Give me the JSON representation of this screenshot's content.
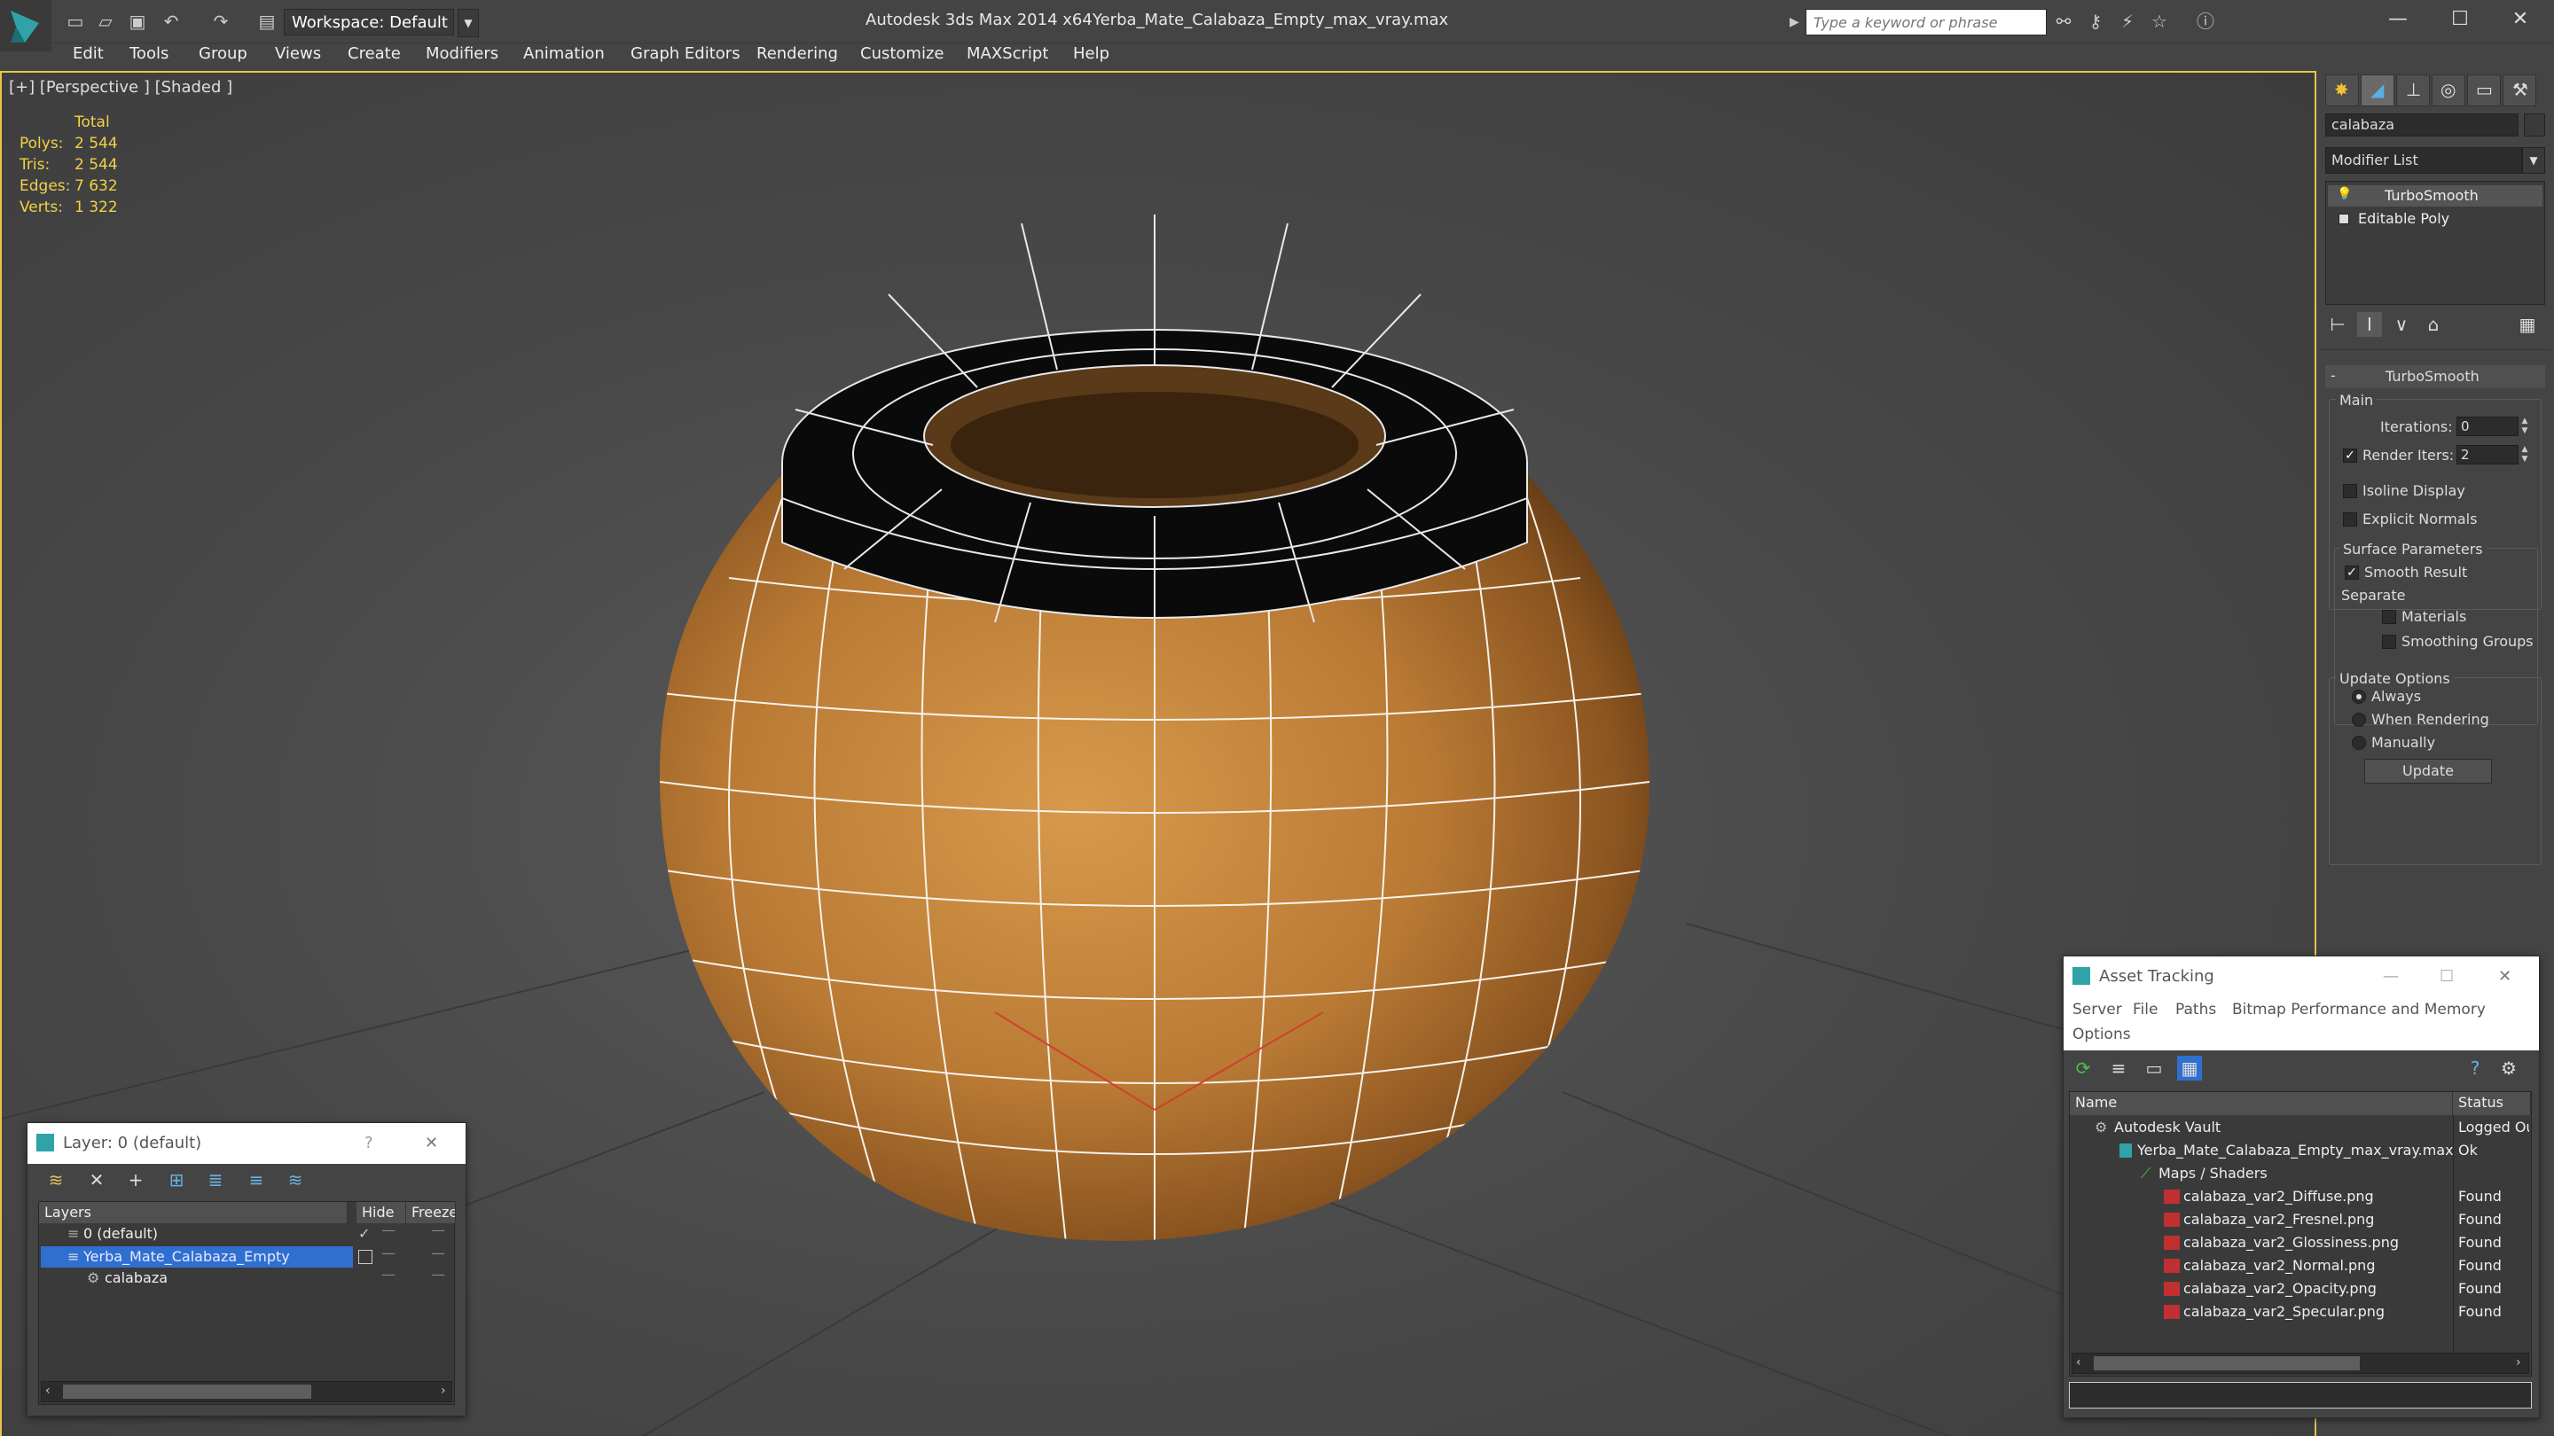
{
  "titlebar": {
    "workspace_label": "Workspace: Default",
    "app_name": "Autodesk 3ds Max  2014 x64",
    "file_name": "Yerba_Mate_Calabaza_Empty_max_vray.max",
    "search_placeholder": "Type a keyword or phrase"
  },
  "menu": [
    "Edit",
    "Tools",
    "Group",
    "Views",
    "Create",
    "Modifiers",
    "Animation",
    "Graph Editors",
    "Rendering",
    "Customize",
    "MAXScript",
    "Help"
  ],
  "viewport": {
    "label": "[+] [Perspective ] [Shaded ]",
    "stats_header": "Total",
    "stats": [
      {
        "label": "Polys:",
        "value": "2 544"
      },
      {
        "label": "Tris:",
        "value": "2 544"
      },
      {
        "label": "Edges:",
        "value": "7 632"
      },
      {
        "label": "Verts:",
        "value": "1 322"
      }
    ]
  },
  "command_panel": {
    "object_name": "calabaza",
    "modifier_list_label": "Modifier List",
    "stack": [
      "TurboSmooth",
      "Editable Poly"
    ],
    "rollout_title": "TurboSmooth",
    "main_group": "Main",
    "iterations_label": "Iterations:",
    "iterations_value": "0",
    "render_iters_label": "Render Iters:",
    "render_iters_value": "2",
    "isoline_label": "Isoline Display",
    "explicit_normals_label": "Explicit Normals",
    "surface_group": "Surface Parameters",
    "smooth_result_label": "Smooth Result",
    "separate_label": "Separate",
    "materials_label": "Materials",
    "smoothing_groups_label": "Smoothing Groups",
    "update_group": "Update Options",
    "always_label": "Always",
    "when_rendering_label": "When Rendering",
    "manually_label": "Manually",
    "update_button": "Update"
  },
  "layer_window": {
    "title": "Layer: 0 (default)",
    "help_icon": "?",
    "columns": [
      "Layers",
      "Hide",
      "Freeze"
    ],
    "rows": [
      "0 (default)",
      "Yerba_Mate_Calabaza_Empty",
      "calabaza"
    ]
  },
  "asset_window": {
    "title": "Asset Tracking",
    "menu": [
      "Server",
      "File",
      "Paths",
      "Bitmap Performance and Memory",
      "Options"
    ],
    "columns": [
      "Name",
      "Status"
    ],
    "rows": [
      {
        "name": "Autodesk Vault",
        "status": "Logged Out"
      },
      {
        "name": "Yerba_Mate_Calabaza_Empty_max_vray.max",
        "status": "Ok"
      },
      {
        "name": "Maps / Shaders",
        "status": ""
      },
      {
        "name": "calabaza_var2_Diffuse.png",
        "status": "Found"
      },
      {
        "name": "calabaza_var2_Fresnel.png",
        "status": "Found"
      },
      {
        "name": "calabaza_var2_Glossiness.png",
        "status": "Found"
      },
      {
        "name": "calabaza_var2_Normal.png",
        "status": "Found"
      },
      {
        "name": "calabaza_var2_Opacity.png",
        "status": "Found"
      },
      {
        "name": "calabaza_var2_Specular.png",
        "status": "Found"
      }
    ]
  }
}
